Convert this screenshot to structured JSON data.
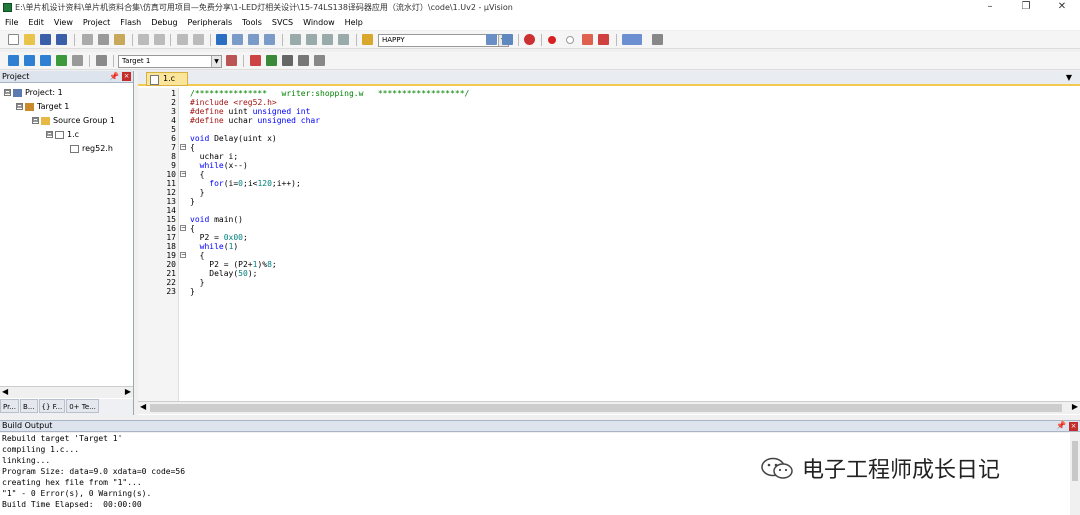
{
  "window": {
    "title": "E:\\单片机设计资料\\单片机资料合集\\仿真可用项目—免费分享\\1-LED灯相关设计\\15-74LS138译码器应用（流水灯）\\code\\1.Uv2 - µVision",
    "minimize": "–",
    "restore": "❐",
    "close": "✕"
  },
  "menu": [
    "File",
    "Edit",
    "View",
    "Project",
    "Flash",
    "Debug",
    "Peripherals",
    "Tools",
    "SVCS",
    "Window",
    "Help"
  ],
  "toolbar1": {
    "find_combo": "HAPPY"
  },
  "toolbar2": {
    "target_combo": "Target 1"
  },
  "project_pane": {
    "title": "Project",
    "tree": [
      {
        "label": "Project: 1",
        "expander": "⊟"
      },
      {
        "label": "Target 1",
        "expander": "⊟"
      },
      {
        "label": "Source Group 1",
        "expander": "⊟"
      },
      {
        "label": "1.c",
        "expander": "⊟"
      },
      {
        "label": "reg52.h",
        "expander": ""
      }
    ],
    "tabs": [
      "Pr...",
      "B...",
      "{} F...",
      "0+ Te..."
    ]
  },
  "editor": {
    "tab_label": "1.c",
    "line_numbers": [
      "1",
      "2",
      "3",
      "4",
      "5",
      "6",
      "7",
      "8",
      "9",
      "10",
      "11",
      "12",
      "13",
      "14",
      "15",
      "16",
      "17",
      "18",
      "19",
      "20",
      "21",
      "22",
      "23"
    ],
    "lines": [
      [
        {
          "t": "/***************   writer:shopping.w   ******************/",
          "c": "cmt"
        }
      ],
      [
        {
          "t": "#include ",
          "c": "pp"
        },
        {
          "t": "<reg52.h>",
          "c": "pp"
        }
      ],
      [
        {
          "t": "#define ",
          "c": "pp"
        },
        {
          "t": "uint ",
          "c": ""
        },
        {
          "t": "unsigned int",
          "c": "kw"
        }
      ],
      [
        {
          "t": "#define ",
          "c": "pp"
        },
        {
          "t": "uchar ",
          "c": ""
        },
        {
          "t": "unsigned char",
          "c": "kw"
        }
      ],
      [
        {
          "t": "",
          "c": ""
        }
      ],
      [
        {
          "t": "void",
          "c": "kw"
        },
        {
          "t": " Delay(uint x)",
          "c": ""
        }
      ],
      [
        {
          "t": "{",
          "c": ""
        }
      ],
      [
        {
          "t": "  uchar i;",
          "c": ""
        }
      ],
      [
        {
          "t": "  ",
          "c": ""
        },
        {
          "t": "while",
          "c": "kw"
        },
        {
          "t": "(x--)",
          "c": ""
        }
      ],
      [
        {
          "t": "  {",
          "c": ""
        }
      ],
      [
        {
          "t": "    ",
          "c": ""
        },
        {
          "t": "for",
          "c": "kw"
        },
        {
          "t": "(i=",
          "c": ""
        },
        {
          "t": "0",
          "c": "num"
        },
        {
          "t": ";i<",
          "c": ""
        },
        {
          "t": "120",
          "c": "num"
        },
        {
          "t": ";i++);",
          "c": ""
        }
      ],
      [
        {
          "t": "  }",
          "c": ""
        }
      ],
      [
        {
          "t": "}",
          "c": ""
        }
      ],
      [
        {
          "t": "",
          "c": ""
        }
      ],
      [
        {
          "t": "void",
          "c": "kw"
        },
        {
          "t": " main()",
          "c": ""
        }
      ],
      [
        {
          "t": "{",
          "c": ""
        }
      ],
      [
        {
          "t": "  P2 = ",
          "c": ""
        },
        {
          "t": "0x00",
          "c": "num"
        },
        {
          "t": ";",
          "c": ""
        }
      ],
      [
        {
          "t": "  ",
          "c": ""
        },
        {
          "t": "while",
          "c": "kw"
        },
        {
          "t": "(",
          "c": ""
        },
        {
          "t": "1",
          "c": "num"
        },
        {
          "t": ")",
          "c": ""
        }
      ],
      [
        {
          "t": "  {",
          "c": ""
        }
      ],
      [
        {
          "t": "    P2 = (P2+",
          "c": ""
        },
        {
          "t": "1",
          "c": "num"
        },
        {
          "t": ")%",
          "c": ""
        },
        {
          "t": "8",
          "c": "num"
        },
        {
          "t": ";",
          "c": ""
        }
      ],
      [
        {
          "t": "    Delay(",
          "c": ""
        },
        {
          "t": "50",
          "c": "num"
        },
        {
          "t": ");",
          "c": ""
        }
      ],
      [
        {
          "t": "  }",
          "c": ""
        }
      ],
      [
        {
          "t": "}",
          "c": ""
        }
      ]
    ],
    "folds": [
      7,
      10,
      16,
      19
    ]
  },
  "build_output": {
    "title": "Build Output",
    "lines": [
      "Rebuild target 'Target 1'",
      "compiling 1.c...",
      "linking...",
      "Program Size: data=9.0 xdata=0 code=56",
      "creating hex file from \"1\"...",
      "\"1\" - 0 Error(s), 0 Warning(s).",
      "Build Time Elapsed:  00:00:00"
    ]
  },
  "watermark": {
    "text": "电子工程师成长日记"
  },
  "colors": {
    "comment": "#008000",
    "keyword": "#0000ff",
    "preprocessor": "#a31515",
    "number": "#008080",
    "active_tab": "#fbe59b"
  }
}
